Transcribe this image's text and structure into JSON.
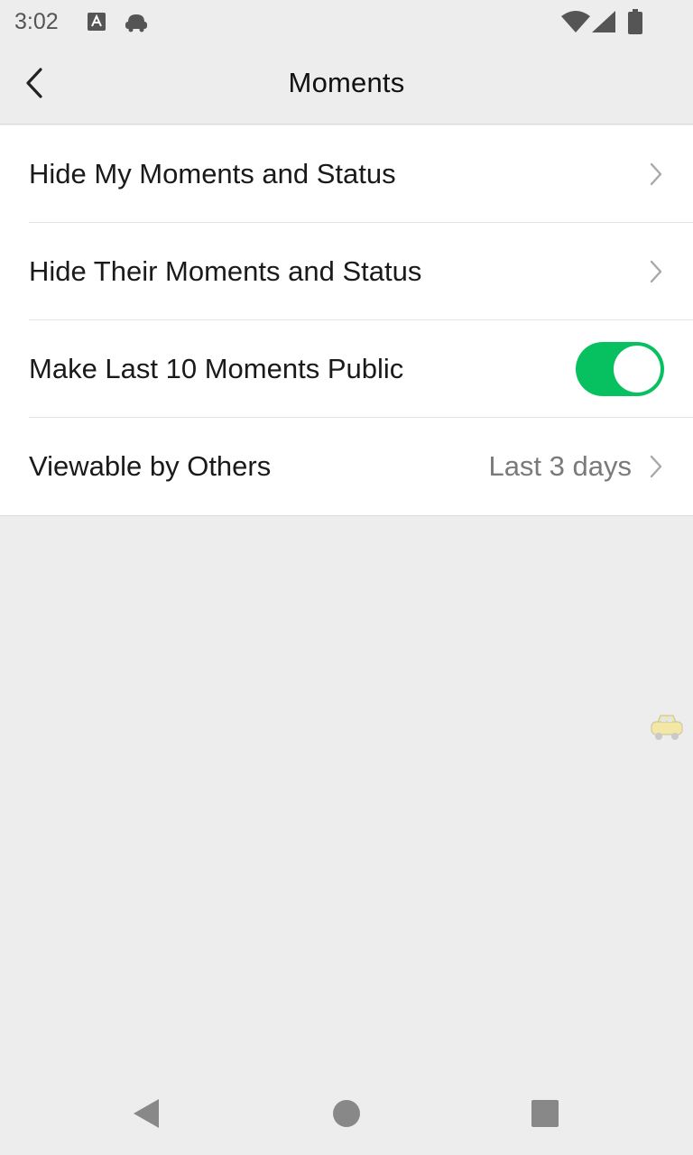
{
  "status_bar": {
    "time": "3:02",
    "icons": [
      "keyboard-a-icon",
      "android-icon",
      "wifi-icon",
      "cell-signal-icon",
      "battery-icon"
    ]
  },
  "header": {
    "title": "Moments",
    "back_icon": "chevron-left-icon"
  },
  "settings": {
    "items": [
      {
        "label": "Hide My Moments and Status",
        "icon": "chevron-right-icon"
      },
      {
        "label": "Hide Their Moments and Status",
        "icon": "chevron-right-icon"
      },
      {
        "label": "Make Last 10 Moments Public",
        "toggle_on": true
      },
      {
        "label": "Viewable by Others",
        "value": "Last 3 days",
        "icon": "chevron-right-icon"
      }
    ]
  },
  "floating": {
    "icon": "car-icon"
  },
  "nav_bar": {
    "buttons": [
      "back-triangle-icon",
      "home-circle-icon",
      "recents-square-icon"
    ]
  },
  "colors": {
    "accent": "#07c160",
    "background": "#ededed",
    "surface": "#ffffff",
    "text_primary": "#1a1a1a",
    "text_secondary": "#7a7a7a"
  }
}
